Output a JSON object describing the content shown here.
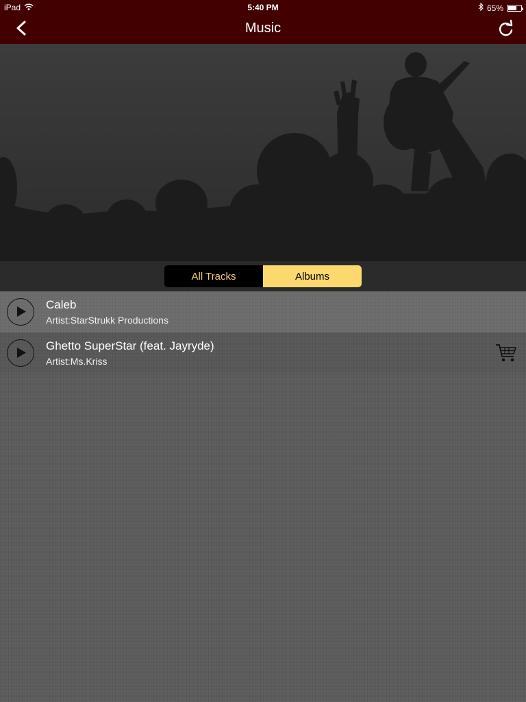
{
  "status_bar": {
    "device": "iPad",
    "time": "5:40 PM",
    "battery": "65%",
    "battery_level": 0.65,
    "icons": [
      "wifi-icon",
      "bluetooth-icon",
      "battery-icon"
    ]
  },
  "nav": {
    "title": "Music",
    "back_icon": "chevron-left-icon",
    "refresh_icon": "refresh-icon",
    "bar_color": "#430000"
  },
  "segments": {
    "items": [
      {
        "label": "All Tracks",
        "selected": false
      },
      {
        "label": "Albums",
        "selected": true
      }
    ],
    "active_color": "#fcd86e",
    "inactive_text_color": "#f4cf6b"
  },
  "tracks": [
    {
      "title": "Caleb",
      "artist": "Artist:StarStrukk Productions",
      "has_cart": false
    },
    {
      "title": "Ghetto SuperStar (feat. Jayryde)",
      "artist": "Artist:Ms.Kriss",
      "has_cart": true
    }
  ]
}
